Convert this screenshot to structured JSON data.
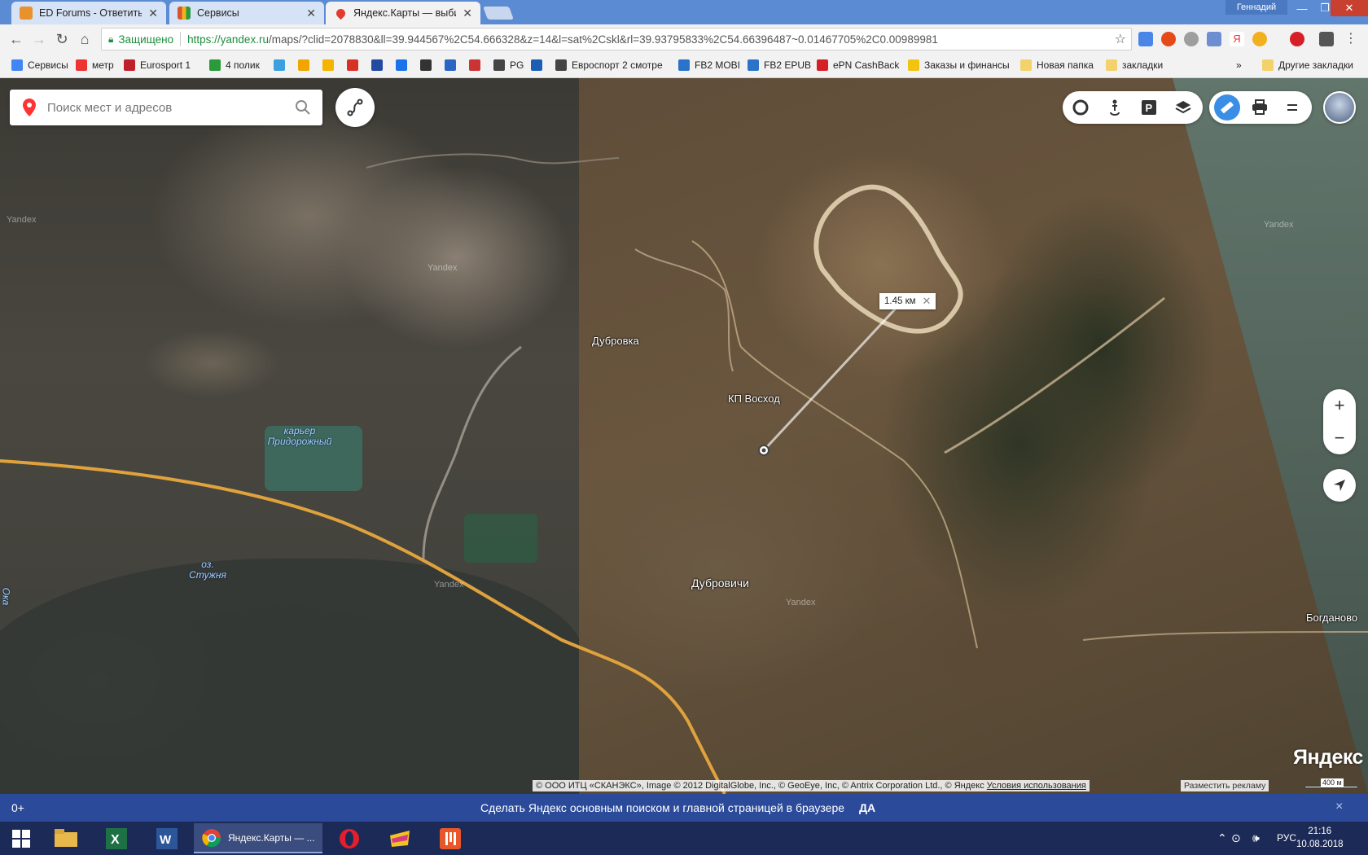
{
  "browser": {
    "tabs": [
      {
        "title": "ED Forums - Ответить в",
        "color": "#e8912d"
      },
      {
        "title": "Сервисы",
        "color": "#d6542e"
      },
      {
        "title": "Яндекс.Карты — выбира",
        "color": "#e23b2e",
        "active": true
      }
    ],
    "profile_name": "Геннадий",
    "address": {
      "secure_label": "Защищено",
      "url_host": "https://yandex.ru",
      "url_rest": "/maps/?clid=2078830&ll=39.944567%2C54.666328&z=14&l=sat%2Cskl&rl=39.93795833%2C54.66396487~0.01467705%2C0.00989981"
    },
    "bookmarks": [
      {
        "label": "Сервисы",
        "color": "#4285f4"
      },
      {
        "label": "метр",
        "color": "#e33"
      },
      {
        "label": "Eurosport 1",
        "color": "#c0202a"
      },
      {
        "label": "4 полик",
        "color": "#2b9a3a"
      },
      {
        "label": "",
        "color": "#3aa0e0"
      },
      {
        "label": "",
        "color": "#f0a500"
      },
      {
        "label": "",
        "color": "#f5b400"
      },
      {
        "label": "",
        "color": "#d93025"
      },
      {
        "label": "",
        "color": "#224aa0"
      },
      {
        "label": "",
        "color": "#1a73e8"
      },
      {
        "label": "",
        "color": "#333"
      },
      {
        "label": "",
        "color": "#2a64c5"
      },
      {
        "label": "",
        "color": "#c33"
      },
      {
        "label": "PG",
        "color": "#444"
      },
      {
        "label": "",
        "color": "#1b5fb5"
      },
      {
        "label": "Евроспорт 2 смотре",
        "color": "#444"
      },
      {
        "label": "FB2 MOBI",
        "color": "#2a73c8"
      },
      {
        "label": "FB2 EPUB",
        "color": "#2a73c8"
      },
      {
        "label": "ePN CashBack",
        "color": "#d61f26"
      },
      {
        "label": "Заказы и финансы",
        "color": "#f1c40f"
      },
      {
        "label": "Новая папка",
        "color": "#f3d26b"
      },
      {
        "label": "закладки",
        "color": "#f3d26b"
      },
      {
        "label": "Другие закладки",
        "color": "#f3d26b"
      }
    ],
    "bookmarks_more": "»"
  },
  "map": {
    "search_placeholder": "Поиск мест и адресов",
    "labels": {
      "dubrovka": "Дубровка",
      "kp_voskhod": "КП Восход",
      "dubrovichi": "Дубровичи",
      "bogdanovo": "Богданово",
      "quarry": "карьер\nПридорожный",
      "lake": "оз.\nСтужня",
      "river_edge": "Ока"
    },
    "watermark": "Yandex",
    "distance": "1.45 км",
    "logo": "Яндекс",
    "copyright": "© ООО ИТЦ «СКАНЭКС», Image © 2012 DigitalGlobe, Inc., © GeoEye, Inc, © Antrix Corporation Ltd., © Яндекс",
    "terms_link": "Условия использования",
    "ad_link": "Разместить рекламу",
    "scale": "400 м",
    "zoom_in": "+",
    "zoom_out": "−"
  },
  "notify": {
    "counter": "0+",
    "message": "Сделать Яндекс основным поиском и главной страницей в браузере",
    "accept": "ДА",
    "close": "×"
  },
  "taskbar": {
    "chrome_label": "Яндекс.Карты — ...",
    "lang": "РУС",
    "time": "21:16",
    "date": "10.08.2018"
  }
}
